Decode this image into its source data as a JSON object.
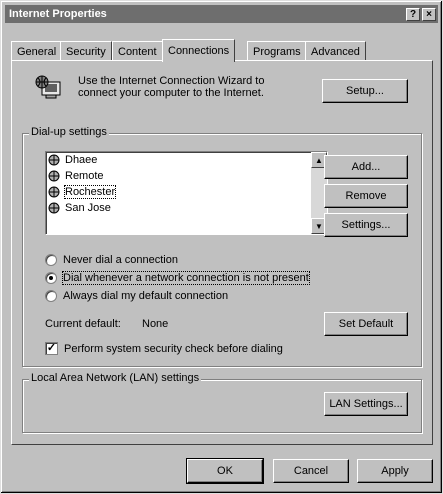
{
  "window": {
    "title": "Internet Properties",
    "help_glyph": "?",
    "close_glyph": "×"
  },
  "tabs": [
    {
      "label": "General",
      "active": false
    },
    {
      "label": "Security",
      "active": false
    },
    {
      "label": "Content",
      "active": false
    },
    {
      "label": "Connections",
      "active": true
    },
    {
      "label": "Programs",
      "active": false
    },
    {
      "label": "Advanced",
      "active": false
    }
  ],
  "wizard": {
    "line1": "Use the Internet Connection Wizard to",
    "line2": "connect your computer to the Internet.",
    "setup_label": "Setup..."
  },
  "dialup": {
    "title": "Dial-up settings",
    "connections": [
      {
        "label": "Dhaee",
        "selected": false
      },
      {
        "label": "Remote",
        "selected": false
      },
      {
        "label": "Rochester",
        "selected": true
      },
      {
        "label": "San Jose",
        "selected": false
      }
    ],
    "add_label": "Add...",
    "remove_label": "Remove",
    "settings_label": "Settings...",
    "options": [
      {
        "label": "Never dial a connection",
        "checked": false
      },
      {
        "label": "Dial whenever a network connection is not present",
        "checked": true
      },
      {
        "label": "Always dial my default connection",
        "checked": false
      }
    ],
    "current_default_label": "Current default:",
    "current_default_value": "None",
    "set_default_label": "Set Default",
    "security_check_label": "Perform system security check before dialing",
    "security_check_checked": true,
    "scroll_up_glyph": "▲",
    "scroll_down_glyph": "▼"
  },
  "lan": {
    "title": "Local Area Network (LAN) settings",
    "lan_settings_label": "LAN Settings..."
  },
  "footer": {
    "ok_label": "OK",
    "cancel_label": "Cancel",
    "apply_label": "Apply"
  }
}
